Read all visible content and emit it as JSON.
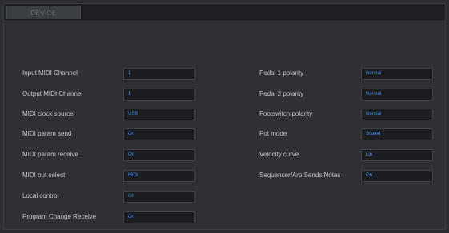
{
  "tabs": [
    {
      "label": "DEVICE"
    }
  ],
  "left": [
    {
      "label": "Input MIDI Channel",
      "value": "1"
    },
    {
      "label": "Output MIDI Channel",
      "value": "1"
    },
    {
      "label": "MIDI clock source",
      "value": "USB"
    },
    {
      "label": "MIDI param send",
      "value": "On"
    },
    {
      "label": "MIDI param receive",
      "value": "On"
    },
    {
      "label": "MIDI out select",
      "value": "MIDI"
    },
    {
      "label": "Local control",
      "value": "On"
    },
    {
      "label": "Program Change Receive",
      "value": "On"
    }
  ],
  "right": [
    {
      "label": "Pedal 1 polarity",
      "value": "Normal"
    },
    {
      "label": "Pedal 2 polarity",
      "value": "Normal"
    },
    {
      "label": "Footswitch polarity",
      "value": "Normal"
    },
    {
      "label": "Pot mode",
      "value": "Scaled"
    },
    {
      "label": "Velocity curve",
      "value": "Lin"
    },
    {
      "label": "Sequencer/Arp Sends Notes",
      "value": "On"
    }
  ],
  "colors": {
    "value_text": "#3d8df0",
    "label_text": "#c9cbce",
    "background": "#2e3033"
  }
}
